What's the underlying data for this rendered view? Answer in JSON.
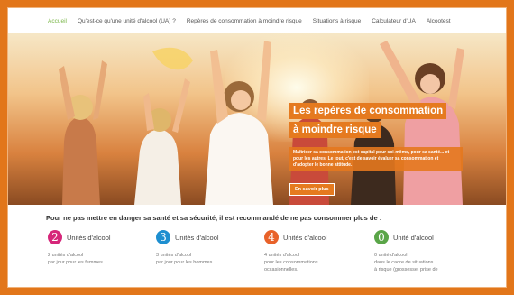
{
  "nav": [
    {
      "label": "Accueil",
      "active": true
    },
    {
      "label": "Qu'est-ce qu'une unité d'alcool (UA) ?"
    },
    {
      "label": "Repères de consommation à moindre risque"
    },
    {
      "label": "Situations à risque"
    },
    {
      "label": "Calculateur d'UA"
    },
    {
      "label": "Alcootest"
    }
  ],
  "hero": {
    "title_line1": "Les repères de consommation",
    "title_line2": "à moindre risque",
    "text": "Maîtriser sa consommation est capital pour soi-même, pour sa santé... et pour les autres. Le tout, c'est de savoir évaluer sa consommation et d'adopter le bonne attitude.",
    "button": "En savoir plus"
  },
  "intro": "Pour ne pas mettre en danger sa santé et sa sécurité, il est recommandé de ne pas consommer plus de :",
  "units": [
    {
      "number": "2",
      "label": "Unités d'alcool",
      "desc_line1": "2 unités d'alcool",
      "desc_line2": "par jour pour les femmes.",
      "desc_line3": "",
      "color": "#d6267a"
    },
    {
      "number": "3",
      "label": "Unités d'alcool",
      "desc_line1": "3 unités d'alcool",
      "desc_line2": "par jour pour les hommes.",
      "desc_line3": "",
      "color": "#1e8fd0"
    },
    {
      "number": "4",
      "label": "Unités d'alcool",
      "desc_line1": "4 unités d'alcool",
      "desc_line2": "pour les consommations",
      "desc_line3": "occasionnelles.",
      "color": "#e8622a"
    },
    {
      "number": "0",
      "label": "Unité d'alcool",
      "desc_line1": "0 unité d'alcool",
      "desc_line2": "dans le cadre de situations",
      "desc_line3": "à risque (grossesse, prise de",
      "color": "#5aa548"
    }
  ]
}
